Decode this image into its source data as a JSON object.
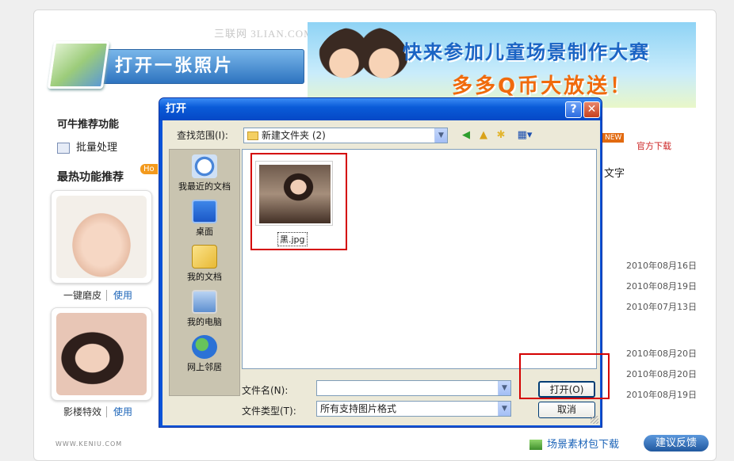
{
  "watermark": "三联网 3LIAN.COM",
  "open_photo_label": "打开一张照片",
  "banner": {
    "title": "快来参加儿童场景制作大赛",
    "subtitle": "多多Q币大放送！"
  },
  "recommended": {
    "title": "可牛推荐功能",
    "batch_label": "批量处理"
  },
  "hot": {
    "title": "最热功能推荐",
    "badge": "Ho"
  },
  "thumbs": [
    {
      "caption": "一键磨皮",
      "action": "使用"
    },
    {
      "caption": "影楼特效",
      "action": "使用"
    }
  ],
  "right": {
    "new_badge": "NEW",
    "official_download": "官方下载",
    "text_label": "文字"
  },
  "dates": [
    "2010年08月16日",
    "2010年08月19日",
    "2010年07月13日",
    "2010年08月20日",
    "2010年08月20日",
    "2010年08月19日"
  ],
  "footer": {
    "logo": "WWW.KENIU.COM",
    "package_download": "场景素材包下载",
    "feedback": "建议反馈"
  },
  "dialog": {
    "title": "打开",
    "help": "?",
    "close": "✕",
    "look_in_label": "查找范围(I):",
    "look_in_value": "新建文件夹 (2)",
    "places": [
      "我最近的文档",
      "桌面",
      "我的文档",
      "我的电脑",
      "网上邻居"
    ],
    "file_name": "黑.jpg",
    "filename_label": "文件名(N):",
    "filename_value": "",
    "filetype_label": "文件类型(T):",
    "filetype_value": "所有支持图片格式",
    "open_button": "打开(O)",
    "cancel_button": "取消"
  }
}
